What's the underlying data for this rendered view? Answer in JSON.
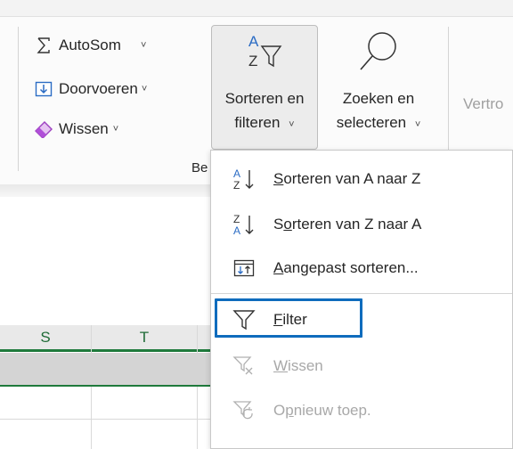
{
  "ribbon": {
    "editing_group": {
      "autosum_label": "AutoSom",
      "fill_label": "Doorvoeren",
      "clear_label": "Wissen",
      "group_label": "Be"
    },
    "sort_filter_button": {
      "line1": "Sorteren en",
      "line2": "filteren"
    },
    "find_select_button": {
      "line1": "Zoeken en",
      "line2": "selecteren"
    },
    "next_group_label": "Vertro",
    "next_group_edge": "ro",
    "chevron_glyph": "˅"
  },
  "grid": {
    "column_headers": [
      "S",
      "T"
    ]
  },
  "sort_filter_menu": {
    "items": [
      {
        "icon": "sort-a-to-z-icon",
        "pre": "",
        "accel": "S",
        "post": "orteren van A naar Z",
        "enabled": true
      },
      {
        "icon": "sort-z-to-a-icon",
        "pre": "S",
        "accel": "o",
        "post": "rteren van Z naar A",
        "enabled": true
      },
      {
        "icon": "custom-sort-icon",
        "pre": "",
        "accel": "A",
        "post": "angepast sorteren...",
        "enabled": true
      },
      {
        "icon": "filter-icon",
        "pre": "",
        "accel": "F",
        "post": "ilter",
        "enabled": true,
        "focused": true
      },
      {
        "icon": "clear-filter-icon",
        "pre": "",
        "accel": "W",
        "post": "issen",
        "enabled": false
      },
      {
        "icon": "reapply-filter-icon",
        "pre": "O",
        "accel": "p",
        "post": "nieuw toep.",
        "enabled": false
      }
    ]
  },
  "colors": {
    "focus_outline": "#0f6cbd",
    "sheet_accent": "#1f7a3c",
    "sort_icon_blue": "#2b6cc4"
  }
}
